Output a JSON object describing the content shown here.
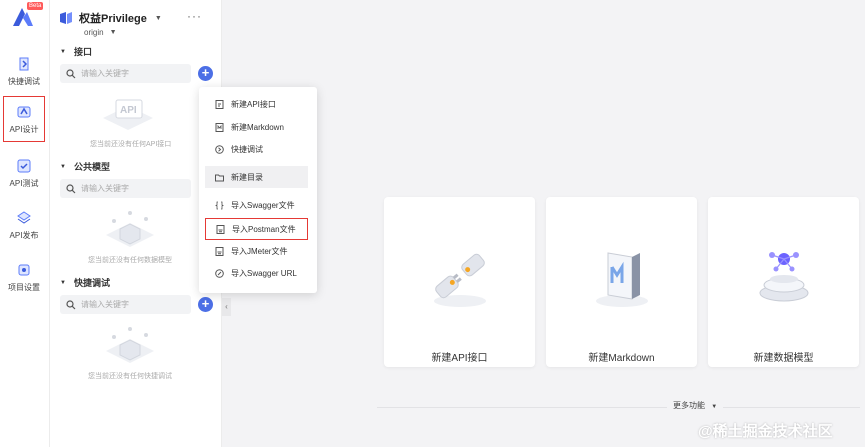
{
  "app": {
    "beta_badge": "Beta"
  },
  "rail": {
    "items": [
      {
        "label": "快捷调试",
        "icon": "quick-debug-icon"
      },
      {
        "label": "API设计",
        "icon": "api-design-icon",
        "active": true
      },
      {
        "label": "API测试",
        "icon": "api-test-icon"
      },
      {
        "label": "API发布",
        "icon": "api-publish-icon"
      },
      {
        "label": "项目设置",
        "icon": "project-settings-icon"
      }
    ]
  },
  "sidebar": {
    "project_name": "权益Privilege",
    "branch": "origin",
    "sections": [
      {
        "title": "接口",
        "search_placeholder": "请输入关键字",
        "empty_text": "您当前还没有任何API接口"
      },
      {
        "title": "公共模型",
        "search_placeholder": "请输入关键字",
        "empty_text": "您当前还没有任何数据模型"
      },
      {
        "title": "快捷调试",
        "search_placeholder": "请输入关键字",
        "empty_text": "您当前还没有任何快捷调试"
      }
    ]
  },
  "menu": {
    "items": [
      {
        "label": "新建API接口",
        "icon": "file-api-icon"
      },
      {
        "label": "新建Markdown",
        "icon": "file-markdown-icon"
      },
      {
        "label": "快捷调试",
        "icon": "quick-debug-icon"
      },
      {
        "label": "新建目录",
        "icon": "folder-icon",
        "hover": true
      },
      {
        "label": "导入Swagger文件",
        "icon": "braces-icon"
      },
      {
        "label": "导入Postman文件",
        "icon": "import-file-icon",
        "highlighted": true
      },
      {
        "label": "导入JMeter文件",
        "icon": "import-file-icon"
      },
      {
        "label": "导入Swagger URL",
        "icon": "link-icon"
      }
    ]
  },
  "main": {
    "cards": [
      {
        "label": "新建API接口",
        "icon": "plug-connect-icon"
      },
      {
        "label": "新建Markdown",
        "icon": "markdown-book-icon"
      },
      {
        "label": "新建数据模型",
        "icon": "data-model-icon"
      }
    ],
    "more_features": "更多功能"
  },
  "watermark": "@稀土掘金技术社区",
  "colors": {
    "accent": "#4c6fe6",
    "highlight_border": "#e53935"
  }
}
